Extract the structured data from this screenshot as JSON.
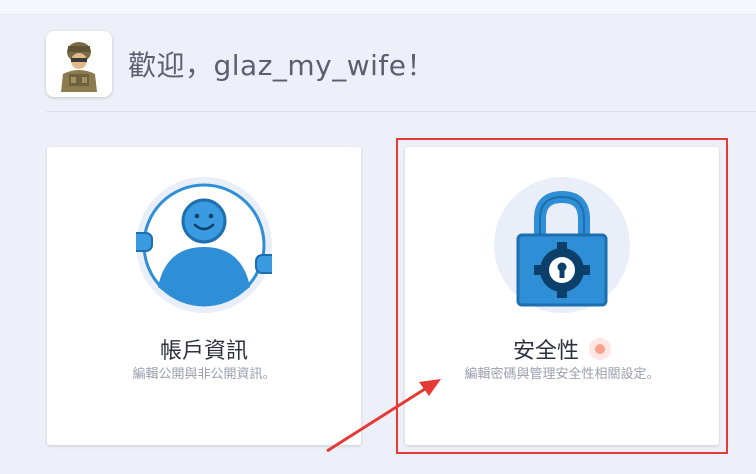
{
  "header": {
    "welcome_text": "歡迎，glaz_my_wife！"
  },
  "cards": {
    "account": {
      "title": "帳戶資訊",
      "description": "編輯公開與非公開資訊。"
    },
    "security": {
      "title": "安全性",
      "description": "編輯密碼與管理安全性相關設定。"
    }
  },
  "icons": {
    "avatar": "soldier-avatar",
    "account": "person-icon",
    "security": "padlock-icon",
    "notification": "notification-dot"
  },
  "colors": {
    "background": "#eef0f9",
    "accent_blue": "#2f8fd6",
    "highlight_red": "#e53935",
    "notify": "#f6a08e"
  }
}
